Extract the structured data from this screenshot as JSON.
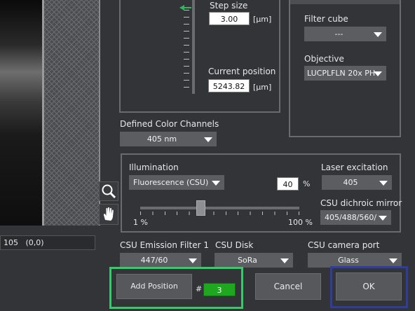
{
  "step": {
    "label": "Step size",
    "value": "3.00",
    "unit": "[µm]"
  },
  "current": {
    "label": "Current position",
    "value": "5243.82",
    "unit": "[µm]"
  },
  "filter_cube": {
    "label": "Filter cube",
    "value": "---"
  },
  "objective": {
    "label": "Objective",
    "value": "LUCPLFLN 20x PH"
  },
  "channels": {
    "label": "Defined Color Channels",
    "value": "405 nm"
  },
  "illumination": {
    "label": "Illumination",
    "value": "Fluorescence (CSU)",
    "percent_value": "40",
    "percent_unit": "%",
    "slider_min": "1 %",
    "slider_max": "100 %",
    "slider_fraction": 0.38
  },
  "laser": {
    "label": "Laser excitation",
    "value": "405"
  },
  "dichroic": {
    "label": "CSU dichroic mirror",
    "value": "405/488/560/"
  },
  "emission": {
    "label": "CSU Emission Filter 1",
    "value": "447/60"
  },
  "disk": {
    "label": "CSU Disk",
    "value": "SoRa"
  },
  "port": {
    "label": "CSU camera port",
    "value": "Glass"
  },
  "status": {
    "coords": "105   (0,0)"
  },
  "actions": {
    "add_position": "Add Position",
    "hash": "#",
    "position_count": "3",
    "cancel": "Cancel",
    "ok": "OK"
  },
  "colors": {
    "green_highlight": "#33cc66",
    "blue_highlight": "#2e3d9e",
    "count_bg": "#1fa81f"
  }
}
